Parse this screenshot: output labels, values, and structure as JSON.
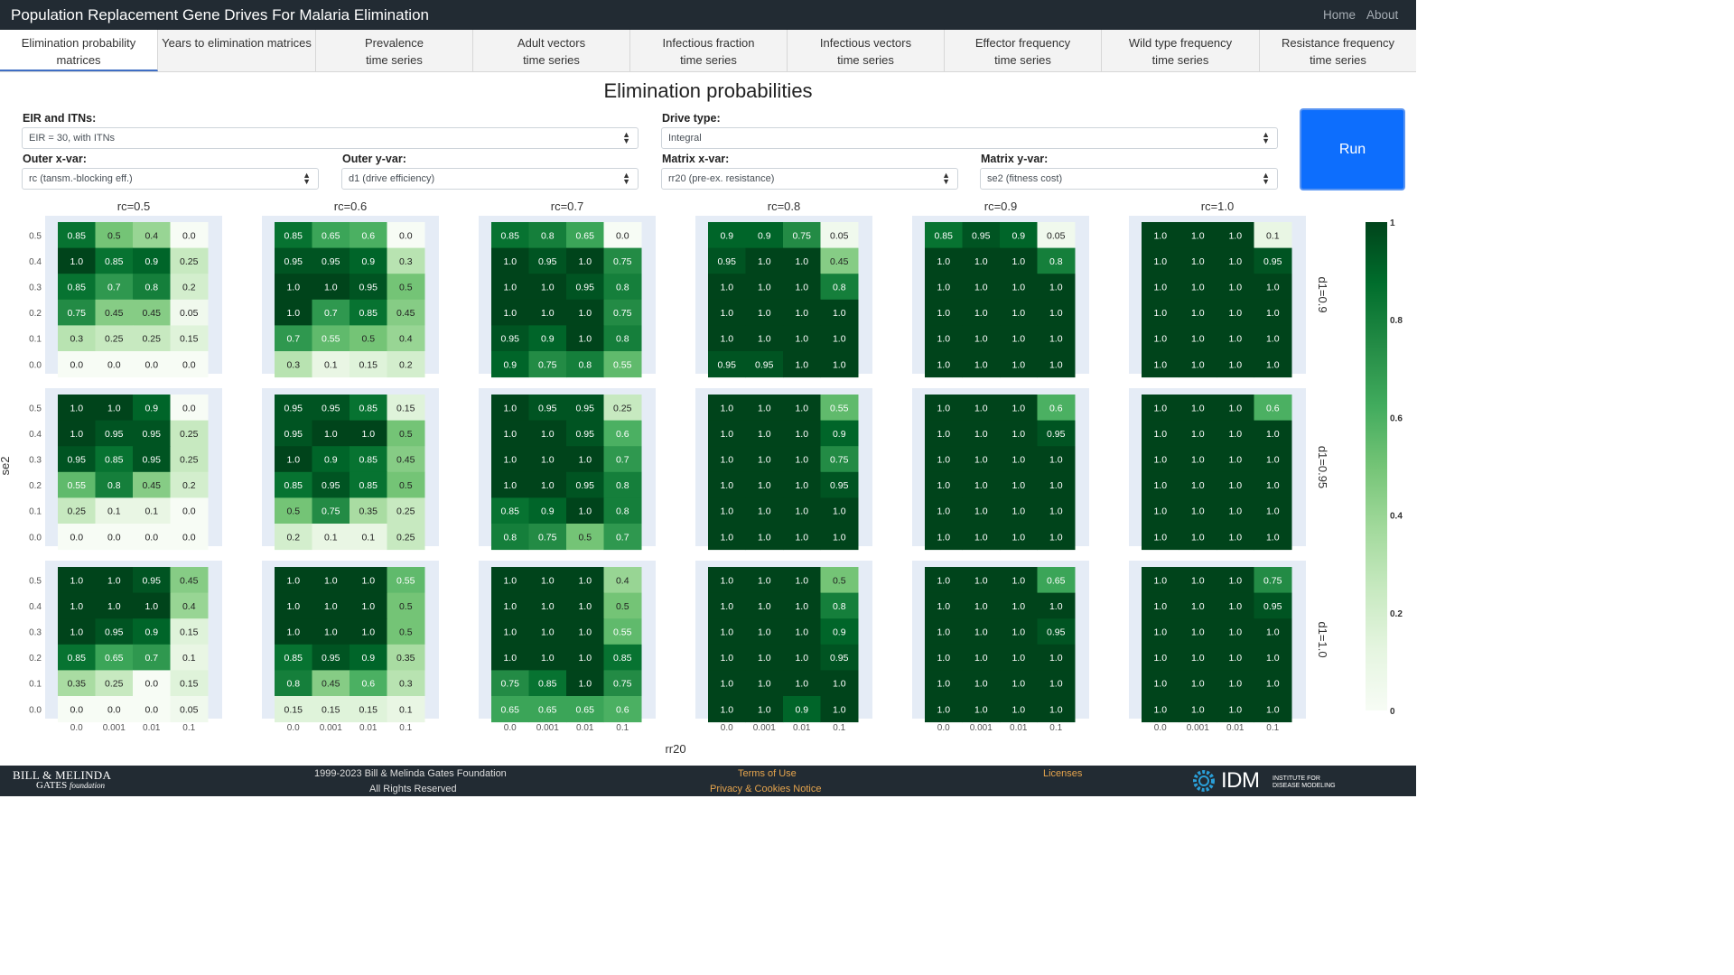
{
  "app": {
    "title": "Population Replacement Gene Drives For Malaria Elimination"
  },
  "nav": {
    "home": "Home",
    "about": "About"
  },
  "tabs": [
    {
      "label": "Elimination probability\nmatrices",
      "active": true
    },
    {
      "label": "Years to elimination matrices",
      "active": false
    },
    {
      "label": "Prevalence\ntime series",
      "active": false
    },
    {
      "label": "Adult vectors\ntime series",
      "active": false
    },
    {
      "label": "Infectious fraction\ntime series",
      "active": false
    },
    {
      "label": "Infectious vectors\ntime series",
      "active": false
    },
    {
      "label": "Effector frequency\ntime series",
      "active": false
    },
    {
      "label": "Wild type frequency\ntime series",
      "active": false
    },
    {
      "label": "Resistance frequency\ntime series",
      "active": false
    }
  ],
  "page_title": "Elimination probabilities",
  "controls": {
    "eir": {
      "label": "EIR and ITNs:",
      "value": "EIR = 30, with ITNs"
    },
    "drive": {
      "label": "Drive type:",
      "value": "Integral"
    },
    "outer_x": {
      "label": "Outer x-var:",
      "value": "rc (tansm.-blocking eff.)"
    },
    "outer_y": {
      "label": "Outer y-var:",
      "value": "d1 (drive efficiency)"
    },
    "matrix_x": {
      "label": "Matrix x-var:",
      "value": "rr20 (pre-ex. resistance)"
    },
    "matrix_y": {
      "label": "Matrix y-var:",
      "value": "se2 (fitness cost)"
    },
    "run_label": "Run"
  },
  "chart_data": {
    "type": "heatmap",
    "colormap": "Greens",
    "xlabel": "rr20",
    "ylabel": "se2",
    "col_facet_labels": [
      "rc=0.5",
      "rc=0.6",
      "rc=0.7",
      "rc=0.8",
      "rc=0.9",
      "rc=1.0"
    ],
    "row_facet_labels": [
      "d1=0.9",
      "d1=0.95",
      "d1=1.0"
    ],
    "x_ticks": [
      "0.0",
      "0.001",
      "0.01",
      "0.1"
    ],
    "y_ticks": [
      "0.5",
      "0.4",
      "0.3",
      "0.2",
      "0.1",
      "0.0"
    ],
    "colorbar": {
      "min": 0,
      "max": 1,
      "ticks": [
        "0",
        "0.2",
        "0.4",
        "0.6",
        "0.8",
        "1"
      ]
    },
    "panels": [
      [
        [
          [
            "0.85",
            "0.5",
            "0.4",
            "0.0"
          ],
          [
            "1.0",
            "0.85",
            "0.9",
            "0.25"
          ],
          [
            "0.85",
            "0.7",
            "0.8",
            "0.2"
          ],
          [
            "0.75",
            "0.45",
            "0.45",
            "0.05"
          ],
          [
            "0.3",
            "0.25",
            "0.25",
            "0.15"
          ],
          [
            "0.0",
            "0.0",
            "0.0",
            "0.0"
          ]
        ],
        [
          [
            "0.85",
            "0.65",
            "0.6",
            "0.0"
          ],
          [
            "0.95",
            "0.95",
            "0.9",
            "0.3"
          ],
          [
            "1.0",
            "1.0",
            "0.95",
            "0.5"
          ],
          [
            "1.0",
            "0.7",
            "0.85",
            "0.45"
          ],
          [
            "0.7",
            "0.55",
            "0.5",
            "0.4"
          ],
          [
            "0.3",
            "0.1",
            "0.15",
            "0.2"
          ]
        ],
        [
          [
            "0.85",
            "0.8",
            "0.65",
            "0.0"
          ],
          [
            "1.0",
            "0.95",
            "1.0",
            "0.75"
          ],
          [
            "1.0",
            "1.0",
            "0.95",
            "0.8"
          ],
          [
            "1.0",
            "1.0",
            "1.0",
            "0.75"
          ],
          [
            "0.95",
            "0.9",
            "1.0",
            "0.8"
          ],
          [
            "0.9",
            "0.75",
            "0.8",
            "0.55"
          ]
        ],
        [
          [
            "0.9",
            "0.9",
            "0.75",
            "0.05"
          ],
          [
            "0.95",
            "1.0",
            "1.0",
            "0.45"
          ],
          [
            "1.0",
            "1.0",
            "1.0",
            "0.8"
          ],
          [
            "1.0",
            "1.0",
            "1.0",
            "1.0"
          ],
          [
            "1.0",
            "1.0",
            "1.0",
            "1.0"
          ],
          [
            "0.95",
            "0.95",
            "1.0",
            "1.0"
          ]
        ],
        [
          [
            "0.85",
            "0.95",
            "0.9",
            "0.05"
          ],
          [
            "1.0",
            "1.0",
            "1.0",
            "0.8"
          ],
          [
            "1.0",
            "1.0",
            "1.0",
            "1.0"
          ],
          [
            "1.0",
            "1.0",
            "1.0",
            "1.0"
          ],
          [
            "1.0",
            "1.0",
            "1.0",
            "1.0"
          ],
          [
            "1.0",
            "1.0",
            "1.0",
            "1.0"
          ]
        ],
        [
          [
            "1.0",
            "1.0",
            "1.0",
            "0.1"
          ],
          [
            "1.0",
            "1.0",
            "1.0",
            "0.95"
          ],
          [
            "1.0",
            "1.0",
            "1.0",
            "1.0"
          ],
          [
            "1.0",
            "1.0",
            "1.0",
            "1.0"
          ],
          [
            "1.0",
            "1.0",
            "1.0",
            "1.0"
          ],
          [
            "1.0",
            "1.0",
            "1.0",
            "1.0"
          ]
        ]
      ],
      [
        [
          [
            "1.0",
            "1.0",
            "0.9",
            "0.0"
          ],
          [
            "1.0",
            "0.95",
            "0.95",
            "0.25"
          ],
          [
            "0.95",
            "0.85",
            "0.95",
            "0.25"
          ],
          [
            "0.55",
            "0.8",
            "0.45",
            "0.2"
          ],
          [
            "0.25",
            "0.1",
            "0.1",
            "0.0"
          ],
          [
            "0.0",
            "0.0",
            "0.0",
            "0.0"
          ]
        ],
        [
          [
            "0.95",
            "0.95",
            "0.85",
            "0.15"
          ],
          [
            "0.95",
            "1.0",
            "1.0",
            "0.5"
          ],
          [
            "1.0",
            "0.9",
            "0.85",
            "0.45"
          ],
          [
            "0.85",
            "0.95",
            "0.85",
            "0.5"
          ],
          [
            "0.5",
            "0.75",
            "0.35",
            "0.25"
          ],
          [
            "0.2",
            "0.1",
            "0.1",
            "0.25"
          ]
        ],
        [
          [
            "1.0",
            "0.95",
            "0.95",
            "0.25"
          ],
          [
            "1.0",
            "1.0",
            "0.95",
            "0.6"
          ],
          [
            "1.0",
            "1.0",
            "1.0",
            "0.7"
          ],
          [
            "1.0",
            "1.0",
            "0.95",
            "0.8"
          ],
          [
            "0.85",
            "0.9",
            "1.0",
            "0.8"
          ],
          [
            "0.8",
            "0.75",
            "0.5",
            "0.7"
          ]
        ],
        [
          [
            "1.0",
            "1.0",
            "1.0",
            "0.55"
          ],
          [
            "1.0",
            "1.0",
            "1.0",
            "0.9"
          ],
          [
            "1.0",
            "1.0",
            "1.0",
            "0.75"
          ],
          [
            "1.0",
            "1.0",
            "1.0",
            "0.95"
          ],
          [
            "1.0",
            "1.0",
            "1.0",
            "1.0"
          ],
          [
            "1.0",
            "1.0",
            "1.0",
            "1.0"
          ]
        ],
        [
          [
            "1.0",
            "1.0",
            "1.0",
            "0.6"
          ],
          [
            "1.0",
            "1.0",
            "1.0",
            "0.95"
          ],
          [
            "1.0",
            "1.0",
            "1.0",
            "1.0"
          ],
          [
            "1.0",
            "1.0",
            "1.0",
            "1.0"
          ],
          [
            "1.0",
            "1.0",
            "1.0",
            "1.0"
          ],
          [
            "1.0",
            "1.0",
            "1.0",
            "1.0"
          ]
        ],
        [
          [
            "1.0",
            "1.0",
            "1.0",
            "0.6"
          ],
          [
            "1.0",
            "1.0",
            "1.0",
            "1.0"
          ],
          [
            "1.0",
            "1.0",
            "1.0",
            "1.0"
          ],
          [
            "1.0",
            "1.0",
            "1.0",
            "1.0"
          ],
          [
            "1.0",
            "1.0",
            "1.0",
            "1.0"
          ],
          [
            "1.0",
            "1.0",
            "1.0",
            "1.0"
          ]
        ]
      ],
      [
        [
          [
            "1.0",
            "1.0",
            "0.95",
            "0.45"
          ],
          [
            "1.0",
            "1.0",
            "1.0",
            "0.4"
          ],
          [
            "1.0",
            "0.95",
            "0.9",
            "0.15"
          ],
          [
            "0.85",
            "0.65",
            "0.7",
            "0.1"
          ],
          [
            "0.35",
            "0.25",
            "0.0",
            "0.15"
          ],
          [
            "0.0",
            "0.0",
            "0.0",
            "0.05"
          ]
        ],
        [
          [
            "1.0",
            "1.0",
            "1.0",
            "0.55"
          ],
          [
            "1.0",
            "1.0",
            "1.0",
            "0.5"
          ],
          [
            "1.0",
            "1.0",
            "1.0",
            "0.5"
          ],
          [
            "0.85",
            "0.95",
            "0.9",
            "0.35"
          ],
          [
            "0.8",
            "0.45",
            "0.6",
            "0.3"
          ],
          [
            "0.15",
            "0.15",
            "0.15",
            "0.1"
          ]
        ],
        [
          [
            "1.0",
            "1.0",
            "1.0",
            "0.4"
          ],
          [
            "1.0",
            "1.0",
            "1.0",
            "0.5"
          ],
          [
            "1.0",
            "1.0",
            "1.0",
            "0.55"
          ],
          [
            "1.0",
            "1.0",
            "1.0",
            "0.85"
          ],
          [
            "0.75",
            "0.85",
            "1.0",
            "0.75"
          ],
          [
            "0.65",
            "0.65",
            "0.65",
            "0.6"
          ]
        ],
        [
          [
            "1.0",
            "1.0",
            "1.0",
            "0.5"
          ],
          [
            "1.0",
            "1.0",
            "1.0",
            "0.8"
          ],
          [
            "1.0",
            "1.0",
            "1.0",
            "0.9"
          ],
          [
            "1.0",
            "1.0",
            "1.0",
            "0.95"
          ],
          [
            "1.0",
            "1.0",
            "1.0",
            "1.0"
          ],
          [
            "1.0",
            "1.0",
            "0.9",
            "1.0"
          ]
        ],
        [
          [
            "1.0",
            "1.0",
            "1.0",
            "0.65"
          ],
          [
            "1.0",
            "1.0",
            "1.0",
            "1.0"
          ],
          [
            "1.0",
            "1.0",
            "1.0",
            "0.95"
          ],
          [
            "1.0",
            "1.0",
            "1.0",
            "1.0"
          ],
          [
            "1.0",
            "1.0",
            "1.0",
            "1.0"
          ],
          [
            "1.0",
            "1.0",
            "1.0",
            "1.0"
          ]
        ],
        [
          [
            "1.0",
            "1.0",
            "1.0",
            "0.75"
          ],
          [
            "1.0",
            "1.0",
            "1.0",
            "0.95"
          ],
          [
            "1.0",
            "1.0",
            "1.0",
            "1.0"
          ],
          [
            "1.0",
            "1.0",
            "1.0",
            "1.0"
          ],
          [
            "1.0",
            "1.0",
            "1.0",
            "1.0"
          ],
          [
            "1.0",
            "1.0",
            "1.0",
            "1.0"
          ]
        ]
      ]
    ]
  },
  "footer": {
    "foundation_line1": "BILL & MELINDA",
    "foundation_line2": "GATES",
    "foundation_line3": "foundation",
    "copyright": "1999-2023 Bill & Melinda Gates Foundation",
    "rights": "All Rights Reserved",
    "terms": "Terms of Use",
    "privacy": "Privacy & Cookies Notice",
    "licenses": "Licenses",
    "idm": "IDM",
    "idm_sub1": "INSTITUTE FOR",
    "idm_sub2": "DISEASE MODELING",
    "link_color": "#e5a44d"
  }
}
